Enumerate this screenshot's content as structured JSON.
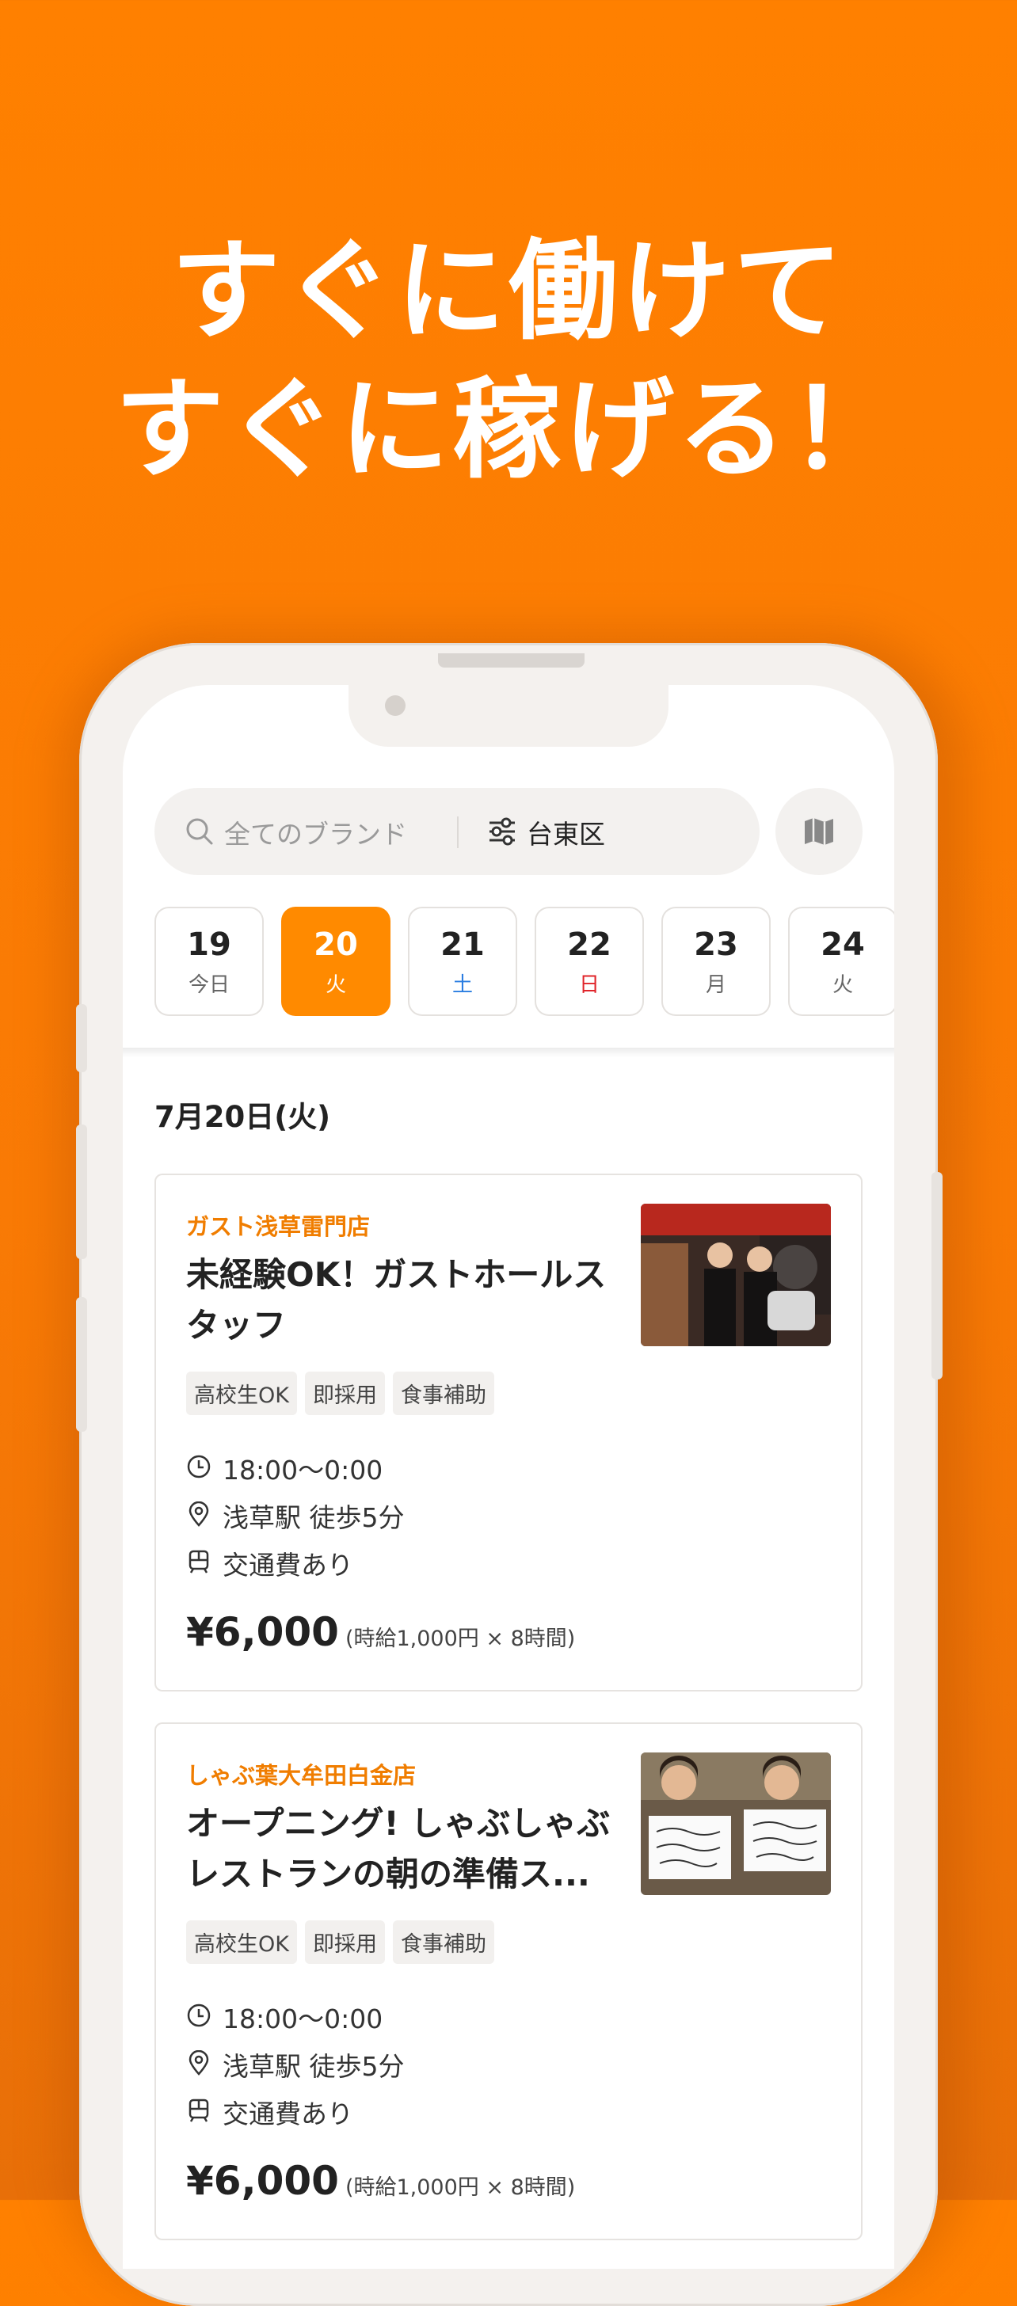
{
  "headline": {
    "line1": "すぐに働けて",
    "line2": "すぐに稼げる！"
  },
  "search": {
    "placeholder": "全てのブランド",
    "area": "台東区"
  },
  "dates": [
    {
      "num": "19",
      "dow": "今日"
    },
    {
      "num": "20",
      "dow": "火",
      "selected": true
    },
    {
      "num": "21",
      "dow": "土"
    },
    {
      "num": "22",
      "dow": "日"
    },
    {
      "num": "23",
      "dow": "月"
    },
    {
      "num": "24",
      "dow": "火"
    }
  ],
  "section_date": "7月20日(火)",
  "jobs": [
    {
      "store": "ガスト浅草雷門店",
      "title": "未経験OK！ガストホールスタッフ",
      "tags": [
        "高校生OK",
        "即採用",
        "食事補助"
      ],
      "time": "18:00〜0:00",
      "station": "浅草駅 徒歩5分",
      "transport": "交通費あり",
      "price": "¥6,000",
      "price_detail": "(時給1,000円 × 8時間)"
    },
    {
      "store": "しゃぶ葉大牟田白金店",
      "title": "オープニング! しゃぶしゃぶレストランの朝の準備ス...",
      "tags": [
        "高校生OK",
        "即採用",
        "食事補助"
      ],
      "time": "18:00〜0:00",
      "station": "浅草駅 徒歩5分",
      "transport": "交通費あり",
      "price": "¥6,000",
      "price_detail": "(時給1,000円 × 8時間)"
    }
  ],
  "colors": {
    "background": "#ff8000",
    "accent": "#ff8a00",
    "store_text": "#f07d00",
    "saturday": "#2a7de1",
    "sunday": "#e0242a"
  },
  "icons": [
    "search-icon",
    "filter-icon",
    "map-icon",
    "clock-icon",
    "pin-icon",
    "train-icon"
  ]
}
